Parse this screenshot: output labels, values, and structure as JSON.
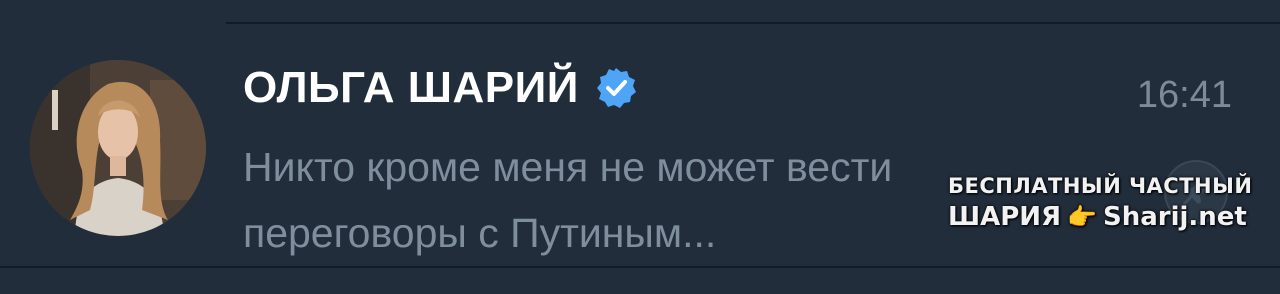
{
  "chat": {
    "name": "ОЛЬГА ШАРИЙ",
    "time": "16:41",
    "preview_line1": "Никто кроме меня не может вести",
    "preview_line2": "переговоры с Путиным..."
  },
  "watermark": {
    "line1": "БЕСПЛАТНЫЙ  ЧАСТНЫЙ",
    "word": "ШАРИЯ",
    "hand": "👉",
    "site": "Sharij.net"
  },
  "icons": {
    "verified": "verified-badge-icon",
    "pin": "pin-icon"
  },
  "colors": {
    "background": "#222d3b",
    "name": "#ffffff",
    "secondary_text": "#7f8e9d",
    "verified_badge": "#4ea4f6"
  }
}
